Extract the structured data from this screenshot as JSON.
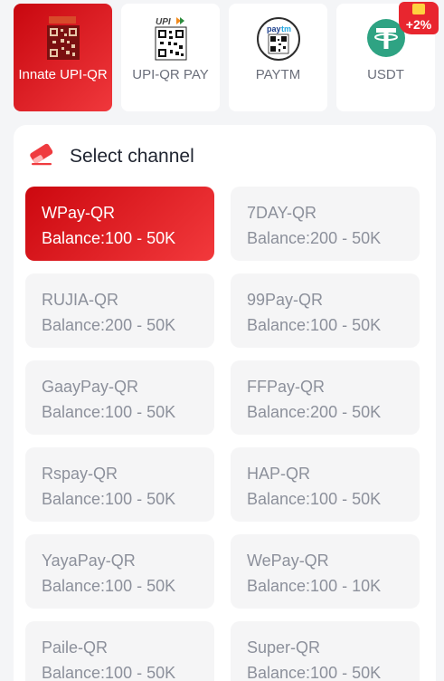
{
  "methods": [
    {
      "label": "Innate UPI-QR",
      "icon": "qr-code-icon",
      "active": true
    },
    {
      "label": "UPI-QR PAY",
      "icon": "upi-qr-icon",
      "active": false
    },
    {
      "label": "PAYTM",
      "icon": "paytm-icon",
      "active": false
    },
    {
      "label": "USDT",
      "icon": "tether-icon",
      "active": false,
      "badge": "+2%"
    }
  ],
  "channel_section": {
    "title": "Select channel",
    "icon": "eraser-icon"
  },
  "channels": [
    {
      "name": "WPay-QR",
      "balance": "Balance:100 - 50K",
      "selected": true
    },
    {
      "name": "7DAY-QR",
      "balance": "Balance:200 - 50K",
      "selected": false
    },
    {
      "name": "RUJIA-QR",
      "balance": "Balance:200 - 50K",
      "selected": false
    },
    {
      "name": "99Pay-QR",
      "balance": "Balance:100 - 50K",
      "selected": false
    },
    {
      "name": "GaayPay-QR",
      "balance": "Balance:100 - 50K",
      "selected": false
    },
    {
      "name": "FFPay-QR",
      "balance": "Balance:200 - 50K",
      "selected": false
    },
    {
      "name": "Rspay-QR",
      "balance": "Balance:100 - 50K",
      "selected": false
    },
    {
      "name": "HAP-QR",
      "balance": "Balance:100 - 50K",
      "selected": false
    },
    {
      "name": "YayaPay-QR",
      "balance": "Balance:100 - 50K",
      "selected": false
    },
    {
      "name": "WePay-QR",
      "balance": "Balance:100 - 10K",
      "selected": false
    },
    {
      "name": "Paile-QR",
      "balance": "Balance:100 - 50K",
      "selected": false
    },
    {
      "name": "Super-QR",
      "balance": "Balance:100 - 50K",
      "selected": false
    }
  ],
  "colors": {
    "accent": "#e0232b",
    "card_bg": "#ffffff",
    "tile_bg": "#f5f5f6",
    "text_muted": "#8c909b"
  }
}
